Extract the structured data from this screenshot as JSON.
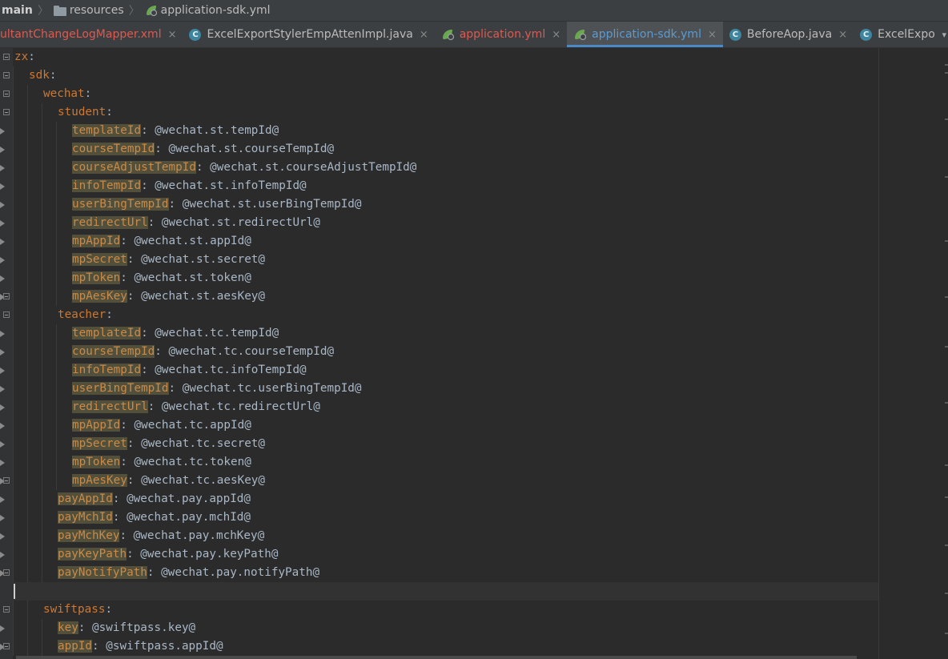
{
  "breadcrumb": {
    "items": [
      {
        "label": "main"
      },
      {
        "label": "resources"
      },
      {
        "label": "application-sdk.yml"
      }
    ]
  },
  "tabs": [
    {
      "label": "ultantChangeLogMapper.xml",
      "icon": "none",
      "color": "red",
      "active": false,
      "close": "×"
    },
    {
      "label": "ExcelExportStylerEmpAttenImpl.java",
      "icon": "class-icon",
      "color": "normal",
      "active": false,
      "close": "×"
    },
    {
      "label": "application.yml",
      "icon": "spring-leaf-icon",
      "color": "red",
      "active": false,
      "close": "×"
    },
    {
      "label": "application-sdk.yml",
      "icon": "spring-leaf-icon",
      "color": "blue",
      "active": true,
      "close": "×"
    },
    {
      "label": "BeforeAop.java",
      "icon": "class-icon",
      "color": "normal",
      "active": false,
      "close": "×"
    },
    {
      "label": "ExcelExpo",
      "icon": "class-icon",
      "color": "normal",
      "active": false,
      "close": ""
    }
  ],
  "tab_overflow": "▾",
  "class_icon_letter": "C",
  "colors": {
    "key": "#cc7832",
    "value": "#a9b7c6",
    "highlight": "#52503a",
    "active_tab_underline": "#4a88c7",
    "background": "#2b2b2b"
  },
  "code": [
    {
      "indent": 0,
      "key": "zx",
      "value": "",
      "hl": false
    },
    {
      "indent": 1,
      "key": "sdk",
      "value": "",
      "hl": false
    },
    {
      "indent": 2,
      "key": "wechat",
      "value": "",
      "hl": false
    },
    {
      "indent": 3,
      "key": "student",
      "value": "",
      "hl": false
    },
    {
      "indent": 4,
      "key": "templateId",
      "value": "@wechat.st.tempId@",
      "hl": true
    },
    {
      "indent": 4,
      "key": "courseTempId",
      "value": "@wechat.st.courseTempId@",
      "hl": true
    },
    {
      "indent": 4,
      "key": "courseAdjustTempId",
      "value": "@wechat.st.courseAdjustTempId@",
      "hl": true
    },
    {
      "indent": 4,
      "key": "infoTempId",
      "value": "@wechat.st.infoTempId@",
      "hl": true
    },
    {
      "indent": 4,
      "key": "userBingTempId",
      "value": "@wechat.st.userBingTempId@",
      "hl": true
    },
    {
      "indent": 4,
      "key": "redirectUrl",
      "value": "@wechat.st.redirectUrl@",
      "hl": true
    },
    {
      "indent": 4,
      "key": "mpAppId",
      "value": "@wechat.st.appId@",
      "hl": true
    },
    {
      "indent": 4,
      "key": "mpSecret",
      "value": "@wechat.st.secret@",
      "hl": true
    },
    {
      "indent": 4,
      "key": "mpToken",
      "value": "@wechat.st.token@",
      "hl": true
    },
    {
      "indent": 4,
      "key": "mpAesKey",
      "value": "@wechat.st.aesKey@",
      "hl": true
    },
    {
      "indent": 3,
      "key": "teacher",
      "value": "",
      "hl": false
    },
    {
      "indent": 4,
      "key": "templateId",
      "value": "@wechat.tc.tempId@",
      "hl": true
    },
    {
      "indent": 4,
      "key": "courseTempId",
      "value": "@wechat.tc.courseTempId@",
      "hl": true
    },
    {
      "indent": 4,
      "key": "infoTempId",
      "value": "@wechat.tc.infoTempId@",
      "hl": true
    },
    {
      "indent": 4,
      "key": "userBingTempId",
      "value": "@wechat.tc.userBingTempId@",
      "hl": true
    },
    {
      "indent": 4,
      "key": "redirectUrl",
      "value": "@wechat.tc.redirectUrl@",
      "hl": true
    },
    {
      "indent": 4,
      "key": "mpAppId",
      "value": "@wechat.tc.appId@",
      "hl": true
    },
    {
      "indent": 4,
      "key": "mpSecret",
      "value": "@wechat.tc.secret@",
      "hl": true
    },
    {
      "indent": 4,
      "key": "mpToken",
      "value": "@wechat.tc.token@",
      "hl": true
    },
    {
      "indent": 4,
      "key": "mpAesKey",
      "value": "@wechat.tc.aesKey@",
      "hl": true
    },
    {
      "indent": 3,
      "key": "payAppId",
      "value": "@wechat.pay.appId@",
      "hl": true
    },
    {
      "indent": 3,
      "key": "payMchId",
      "value": "@wechat.pay.mchId@",
      "hl": true
    },
    {
      "indent": 3,
      "key": "payMchKey",
      "value": "@wechat.pay.mchKey@",
      "hl": true
    },
    {
      "indent": 3,
      "key": "payKeyPath",
      "value": "@wechat.pay.keyPath@",
      "hl": true
    },
    {
      "indent": 3,
      "key": "payNotifyPath",
      "value": "@wechat.pay.notifyPath@",
      "hl": true
    },
    {
      "indent": 0,
      "key": "",
      "value": "",
      "hl": false,
      "caret": true
    },
    {
      "indent": 2,
      "key": "swiftpass",
      "value": "",
      "hl": false
    },
    {
      "indent": 3,
      "key": "key",
      "value": "@swiftpass.key@",
      "hl": true
    },
    {
      "indent": 3,
      "key": "appId",
      "value": "@swiftpass.appId@",
      "hl": true
    }
  ]
}
